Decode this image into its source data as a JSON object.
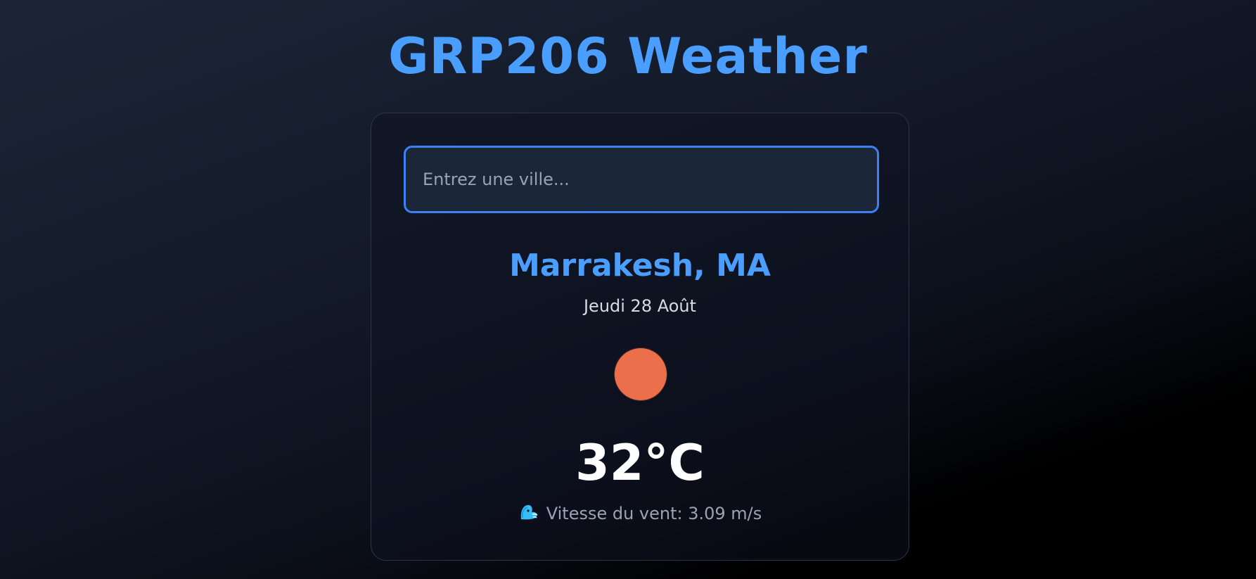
{
  "app": {
    "title": "GRP206 Weather"
  },
  "search": {
    "placeholder": "Entrez une ville...",
    "value": ""
  },
  "weather": {
    "city": "Marrakesh, MA",
    "date": "Jeudi 28 Août",
    "condition_icon": "sun-icon",
    "temperature": "32°C",
    "wind_icon": "wind-face-icon",
    "wind_label": "Vitesse du vent: 3.09 m/s"
  },
  "colors": {
    "accent": "#4a9eff",
    "input_border": "#3b82f6",
    "sun": "#ec6f4c"
  }
}
